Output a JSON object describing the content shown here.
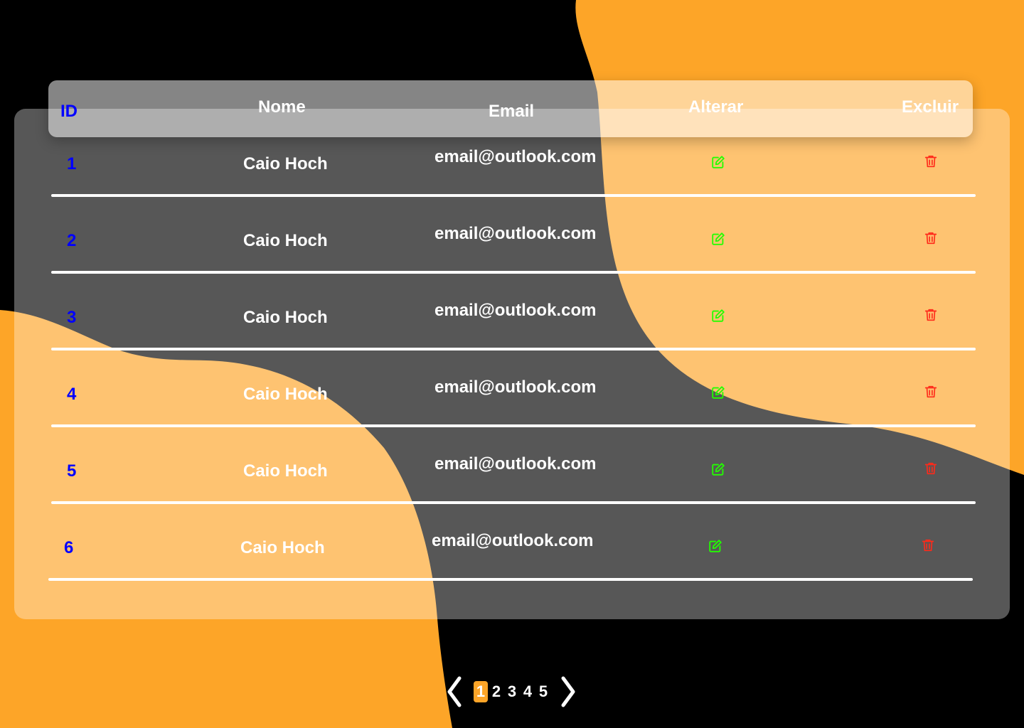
{
  "colors": {
    "background": "#000000",
    "accent_orange": "#fda528",
    "id_blue": "#0000ff",
    "edit_green": "#22ff00",
    "delete_red": "#ff2a1a",
    "text_white": "#ffffff"
  },
  "table": {
    "headers": {
      "id": "ID",
      "nome": "Nome",
      "email": "Email",
      "alterar": "Alterar",
      "excluir": "Excluir"
    },
    "rows": [
      {
        "id": "1",
        "nome": "Caio Hoch",
        "email": "email@outlook.com",
        "alterar_icon": "edit-icon",
        "excluir_icon": "trash-icon"
      },
      {
        "id": "2",
        "nome": "Caio Hoch",
        "email": "email@outlook.com",
        "alterar_icon": "edit-icon",
        "excluir_icon": "trash-icon"
      },
      {
        "id": "3",
        "nome": "Caio Hoch",
        "email": "email@outlook.com",
        "alterar_icon": "edit-icon",
        "excluir_icon": "trash-icon"
      },
      {
        "id": "4",
        "nome": "Caio Hoch",
        "email": "email@outlook.com",
        "alterar_icon": "edit-icon",
        "excluir_icon": "trash-icon"
      },
      {
        "id": "5",
        "nome": "Caio Hoch",
        "email": "email@outlook.com",
        "alterar_icon": "edit-icon",
        "excluir_icon": "trash-icon"
      },
      {
        "id": "6",
        "nome": "Caio Hoch",
        "email": "email@outlook.com",
        "alterar_icon": "edit-icon",
        "excluir_icon": "trash-icon"
      }
    ]
  },
  "pagination": {
    "prev_icon": "chevron-left-icon",
    "next_icon": "chevron-right-icon",
    "pages": [
      "1",
      "2",
      "3",
      "4",
      "5"
    ],
    "current_page": "1"
  }
}
